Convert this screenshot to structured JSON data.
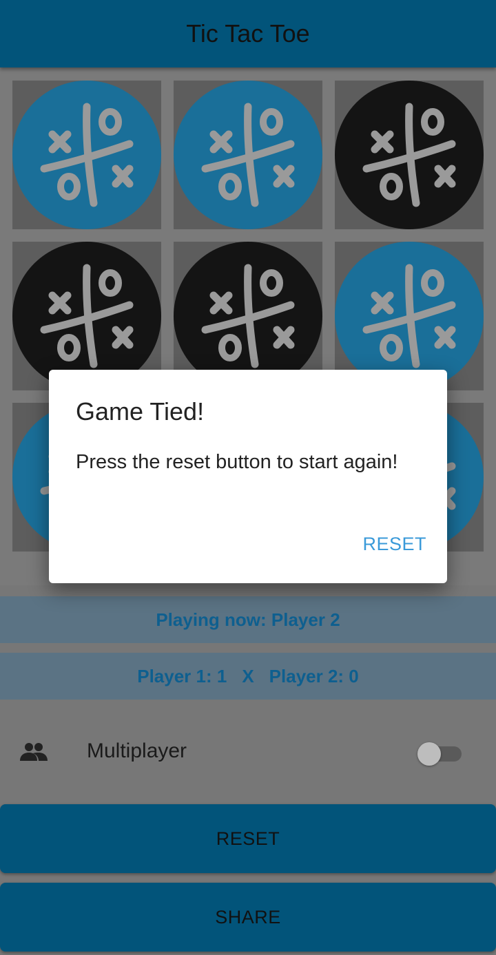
{
  "app": {
    "title": "Tic Tac Toe"
  },
  "colors": {
    "appbar": "#02547a",
    "tile_blue": "#1a6f99",
    "tile_dark": "#141414",
    "symbol": "#9a9a9a",
    "accent": "#3a9ad9"
  },
  "board": {
    "cells": [
      {
        "tile": "blue",
        "icon": "tic-tac-toe-icon"
      },
      {
        "tile": "blue",
        "icon": "tic-tac-toe-icon"
      },
      {
        "tile": "dark",
        "icon": "tic-tac-toe-icon"
      },
      {
        "tile": "dark",
        "icon": "tic-tac-toe-icon"
      },
      {
        "tile": "dark",
        "icon": "tic-tac-toe-icon"
      },
      {
        "tile": "blue",
        "icon": "tic-tac-toe-icon"
      },
      {
        "tile": "blue",
        "icon": "tic-tac-toe-icon"
      },
      {
        "tile": "unknown",
        "icon": "tic-tac-toe-icon"
      },
      {
        "tile": "blue",
        "icon": "tic-tac-toe-icon"
      }
    ]
  },
  "status": {
    "playing_now": "Playing now: Player 2"
  },
  "score": {
    "player1": "Player 1: 1",
    "separator": "X",
    "player2": "Player 2: 0"
  },
  "multiplayer": {
    "icon": "people-icon",
    "label": "Multiplayer",
    "enabled": false
  },
  "buttons": {
    "reset": "RESET",
    "share": "SHARE"
  },
  "dialog": {
    "title": "Game Tied!",
    "message": "Press the reset button to start again!",
    "action": "RESET"
  }
}
